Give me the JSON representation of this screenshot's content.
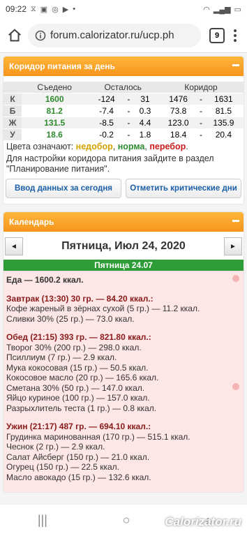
{
  "status": {
    "time": "09:22",
    "battery": ""
  },
  "browser": {
    "url": "forum.calorizator.ru/ucp.ph",
    "tabs": "9"
  },
  "corridor": {
    "title": "Коридор питания за день",
    "headers": {
      "eaten": "Съедено",
      "left": "Осталось",
      "corridor": "Коридор"
    },
    "rows": [
      {
        "label": "К",
        "eaten": "1600",
        "eaten_color": "#2e8b2e",
        "left_from": "-124",
        "left_to": "31",
        "from": "1476",
        "to": "1631"
      },
      {
        "label": "Б",
        "eaten": "81.2",
        "eaten_color": "#2e8b2e",
        "left_from": "-7.4",
        "left_to": "0.3",
        "from": "73.8",
        "to": "81.5"
      },
      {
        "label": "Ж",
        "eaten": "131.5",
        "eaten_color": "#2e8b2e",
        "left_from": "-8.5",
        "left_to": "4.4",
        "from": "123.0",
        "to": "135.9"
      },
      {
        "label": "У",
        "eaten": "18.6",
        "eaten_color": "#2e8b2e",
        "left_from": "-0.2",
        "left_to": "1.8",
        "from": "18.4",
        "to": "20.4"
      }
    ],
    "dash": "-",
    "legend_prefix": "Цвета означают: ",
    "legend_under": "недобор",
    "legend_norm": "норма",
    "legend_over": "перебор",
    "legend_under_color": "#d4a300",
    "legend_norm_color": "#2e8b2e",
    "legend_over_color": "#cc1a1a",
    "comma": ", ",
    "dot": ".",
    "setup_text": "Для настройки коридора питания зайдите в раздел \"Планирование питания\".",
    "btn_input": "Ввод данных за сегодня",
    "btn_mark": "Отметить критические дни"
  },
  "calendar": {
    "title": "Календарь",
    "prev": "◄",
    "next": "►",
    "date": "Пятница, Июл 24, 2020",
    "day_label": "Пятница 24.07",
    "total": "Еда — 1600.2 ккал.",
    "meals": [
      {
        "title": "Завтрак (13:30) 30 гр. — 84.20 ккал.:",
        "items": [
          "Кофе жареный в зёрнах сухой (5 гр.) — 11.2 ккал.",
          "Сливки 30% (25 гр.) — 73.0 ккал."
        ]
      },
      {
        "title": "Обед (21:15) 393 гр. — 821.80 ккал.:",
        "items": [
          "Творог 30% (200 гр.) — 298.0 ккал.",
          "Псиллиум (7 гр.) — 2.9 ккал.",
          "Мука кокосовая (15 гр.) — 50.5 ккал.",
          "Кокосовое масло (20 гр.) — 165.6 ккал.",
          "Сметана 30% (50 гр.) — 147.0 ккал.",
          "Яйцо куриное (100 гр.) — 157.0 ккал.",
          "Разрыхлитель теста (1 гр.) — 0.8 ккал."
        ]
      },
      {
        "title": "Ужин (21:17) 487 гр. — 694.10 ккал.:",
        "items": [
          "Грудинка маринованная (170 гр.) — 515.1 ккал.",
          "Чеснок (2 гр.) — 2.9 ккал.",
          "Салат Айсберг (150 гр.) — 21.0 ккал.",
          "Огурец (150 гр.) — 22.5 ккал.",
          "Масло авокадо (15 гр.) — 132.6 ккал."
        ]
      }
    ]
  },
  "watermark": "Calorizator.ru"
}
